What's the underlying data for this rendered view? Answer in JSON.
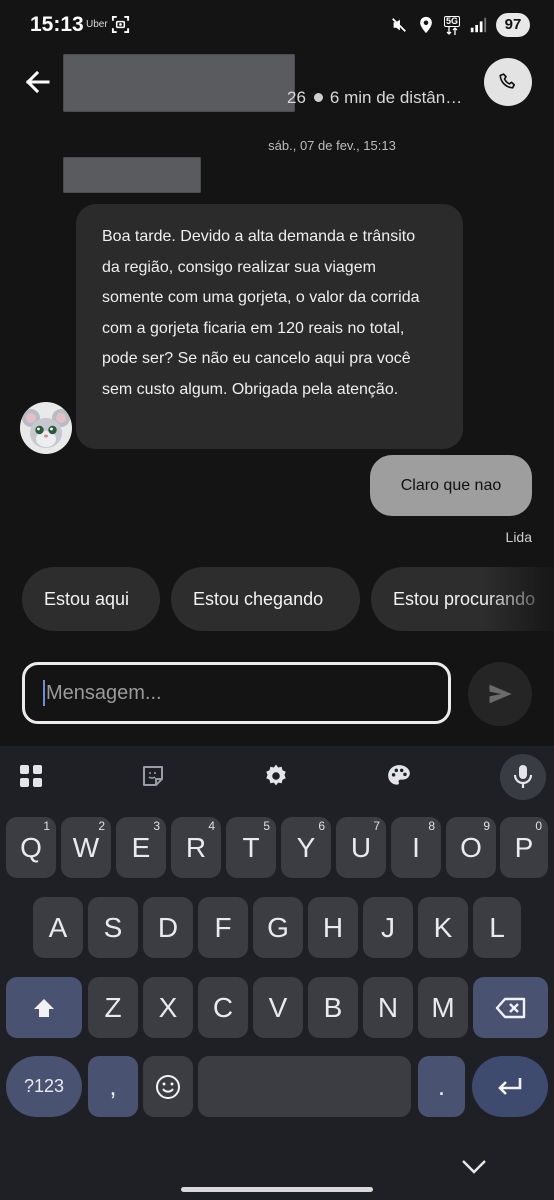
{
  "status_bar": {
    "time": "15:13",
    "app_label": "Uber",
    "network": "5G",
    "battery": "97",
    "icons": [
      "screenshot-icon",
      "mute-vibrate-icon",
      "location-icon",
      "5g-data-icon",
      "signal-icon"
    ]
  },
  "header": {
    "subtitle_number": "26",
    "subtitle_eta": "6 min de distân…",
    "back_icon": "arrow-left-icon",
    "call_icon": "phone-icon"
  },
  "conversation": {
    "date": "sáb., 07 de fev., 15:13",
    "incoming_message": "Boa tarde. Devido a alta demanda e trânsito da região, consigo realizar sua viagem somente com uma gorjeta, o valor da corrida com a gorjeta ficaria em 120 reais no total, pode ser? Se não eu cancelo aqui pra você sem custo algum. Obrigada pela atenção.",
    "outgoing_message": "Claro que nao",
    "read_status": "Lida"
  },
  "quick_replies": [
    "Estou aqui",
    "Estou chegando",
    "Estou procurando"
  ],
  "composer": {
    "placeholder": "Mensagem...",
    "value": "",
    "send_icon": "send-icon"
  },
  "keyboard": {
    "toolbar": [
      "apps-grid-icon",
      "sticker-icon",
      "settings-gear-icon",
      "palette-icon",
      "mic-icon"
    ],
    "row1": [
      "Q",
      "W",
      "E",
      "R",
      "T",
      "Y",
      "U",
      "I",
      "O",
      "P"
    ],
    "row1_hints": [
      "1",
      "2",
      "3",
      "4",
      "5",
      "6",
      "7",
      "8",
      "9",
      "0"
    ],
    "row2": [
      "A",
      "S",
      "D",
      "F",
      "G",
      "H",
      "J",
      "K",
      "L"
    ],
    "row3": [
      "Z",
      "X",
      "C",
      "V",
      "B",
      "N",
      "M"
    ],
    "symbols_key": "?123",
    "comma_key": ",",
    "period_key": ".",
    "shift_icon": "shift-icon",
    "backspace_icon": "backspace-icon",
    "emoji_icon": "emoji-icon",
    "enter_icon": "enter-icon"
  },
  "colors": {
    "background": "#141414",
    "incoming_bubble": "#2b2b2b",
    "outgoing_bubble": "#9e9e9e",
    "keyboard_bg": "#1e2025",
    "key": "#3b3d43",
    "modifier_key": "#4a5272"
  }
}
